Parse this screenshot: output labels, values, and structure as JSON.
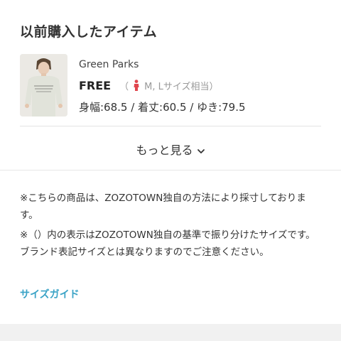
{
  "section_title": "以前購入したアイテム",
  "item": {
    "brand": "Green Parks",
    "size_name": "FREE",
    "size_note_open": "（",
    "size_note_text": "M, Lサイズ相当）",
    "person_icon": "person-icon",
    "measurements": "身幅:68.5 / 着丈:60.5 / ゆき:79.5"
  },
  "show_more": {
    "label": "もっと見る",
    "icon": "chevron-down-icon"
  },
  "notes": [
    "※こちらの商品は、ZOZOTOWN独自の方法により採寸しております。",
    "※（）内の表示はZOZOTOWN独自の基準で振り分けたサイズです。ブランド表記サイズとは異なりますのでご注意ください。"
  ],
  "size_guide_link": "サイズガイド",
  "colors": {
    "link": "#3aa3c6",
    "person_icon": "#e0464e",
    "muted": "#999999"
  }
}
